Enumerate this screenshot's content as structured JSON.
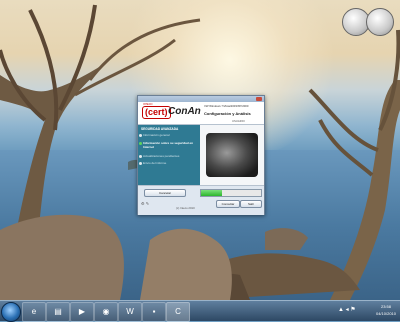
{
  "window": {
    "logo_text": "(cert)",
    "logo_sub": "INTECO",
    "app_name": "ConAn",
    "version": "VW Windows 7/Vista/2003/XP/2000",
    "subtitle": "Configuración y Análisis",
    "user": "USUARIO",
    "sidebar": {
      "heading": "SEGURIDAD AVANZADA",
      "items": [
        {
          "label": "Información general"
        },
        {
          "label": "Información sobre su seguridad en Internet"
        },
        {
          "label": "Actualizaciones pendientes"
        },
        {
          "label": "Envío del informe"
        }
      ]
    },
    "buttons": {
      "cancel": "Cancelar",
      "consult": "Consultar",
      "exit": "Salir"
    },
    "progress": 0.35,
    "copyright": "(c) Inteco 2010"
  },
  "taskbar": {
    "buttons": [
      {
        "icon": "ie-icon",
        "glyph": "e"
      },
      {
        "icon": "folder-icon",
        "glyph": "▤"
      },
      {
        "icon": "media-player-icon",
        "glyph": "▶"
      },
      {
        "icon": "firefox-icon",
        "glyph": "◉"
      },
      {
        "icon": "word-icon",
        "glyph": "W"
      },
      {
        "icon": "cmd-icon",
        "glyph": "▪"
      },
      {
        "icon": "conan-icon",
        "glyph": "C"
      }
    ],
    "clock_time": "23:58",
    "clock_date": "04/10/2010",
    "tray": "▲ ◂ ⚑"
  },
  "colors": {
    "sidebar": "#2f7a93",
    "accent_red": "#c40000",
    "progress_green": "#2db52d"
  }
}
